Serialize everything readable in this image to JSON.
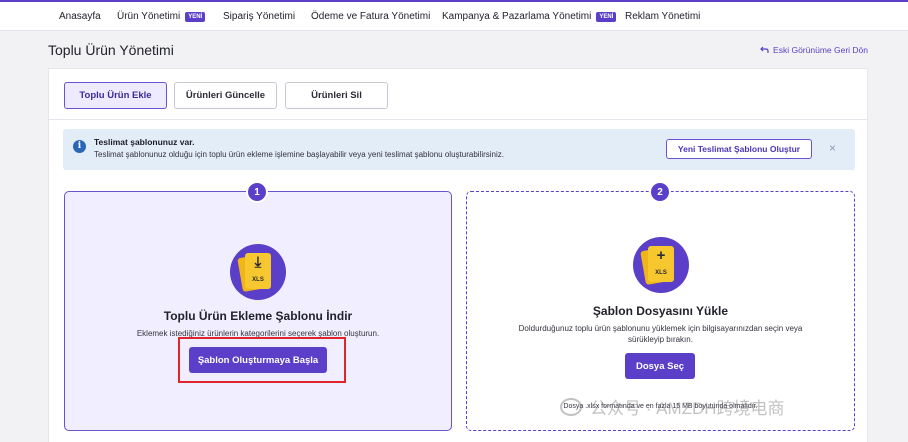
{
  "topnav": {
    "items": [
      {
        "label": "Anasayfa"
      },
      {
        "label": "Ürün Yönetimi",
        "badge": "YENİ"
      },
      {
        "label": "Sipariş Yönetimi"
      },
      {
        "label": "Ödeme ve Fatura Yönetimi"
      },
      {
        "label": "Kampanya & Pazarlama Yönetimi",
        "badge": "YENİ"
      },
      {
        "label": "Reklam Yönetimi"
      }
    ]
  },
  "page": {
    "title": "Toplu Ürün Yönetimi",
    "back_link": "Eski Görünüme Geri Dön"
  },
  "tabs": [
    {
      "label": "Toplu Ürün Ekle",
      "active": true
    },
    {
      "label": "Ürünleri Güncelle",
      "active": false
    },
    {
      "label": "Ürünleri Sil",
      "active": false
    }
  ],
  "alert": {
    "icon": "info-icon",
    "title": "Teslimat şablonunuz var.",
    "text": "Teslimat şablonunuz olduğu için toplu ürün ekleme işlemine başlayabilir veya yeni teslimat şablonu oluşturabilirsiniz.",
    "button": "Yeni Teslimat Şablonu Oluştur",
    "close": "×"
  },
  "step1": {
    "number": "1",
    "icon": "download-xls-icon",
    "icon_text": "XLS",
    "title": "Toplu Ürün Ekleme Şablonu İndir",
    "description": "Eklemek istediğiniz ürünlerin kategorilerini seçerek şablon oluşturun.",
    "button": "Şablon Oluşturmaya Başla"
  },
  "step2": {
    "number": "2",
    "icon": "upload-xls-icon",
    "icon_text": "XLS",
    "title": "Şablon Dosyasını Yükle",
    "description": "Doldurduğunuz toplu ürün şablonunu yüklemek için bilgisayarınızdan seçin veya sürükleyip bırakın.",
    "button": "Dosya Seç",
    "note": "Dosya .xlsx formatında ve en fazla 15 MB boyutunda olmalıdır."
  },
  "watermark": "公众号 · AMZDH跨境电商",
  "colors": {
    "accent": "#5b3fc8",
    "highlight": "#e0242a",
    "alert_bg": "#e3edf8"
  }
}
